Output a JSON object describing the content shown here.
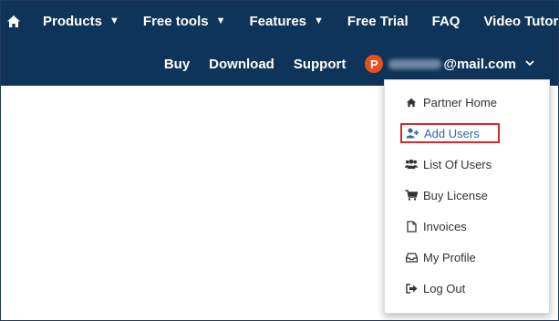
{
  "nav": {
    "home_icon": "home-icon",
    "top_items": [
      {
        "label": "Products",
        "has_dropdown": true
      },
      {
        "label": "Free tools",
        "has_dropdown": true
      },
      {
        "label": "Features",
        "has_dropdown": true
      },
      {
        "label": "Free Trial",
        "has_dropdown": false
      },
      {
        "label": "FAQ",
        "has_dropdown": false
      },
      {
        "label": "Video Tutorials",
        "has_dropdown": false
      }
    ],
    "bottom_items": [
      {
        "label": "Buy"
      },
      {
        "label": "Download"
      },
      {
        "label": "Support"
      }
    ],
    "account": {
      "avatar_letter": "P",
      "email_suffix": "@mail.com"
    }
  },
  "menu": {
    "items": [
      {
        "label": "Partner Home",
        "icon": "home-icon"
      },
      {
        "label": "Add Users",
        "icon": "user-plus-icon",
        "highlighted": true
      },
      {
        "label": "List Of Users",
        "icon": "users-icon"
      },
      {
        "label": "Buy License",
        "icon": "cart-icon"
      },
      {
        "label": "Invoices",
        "icon": "file-icon"
      },
      {
        "label": "My Profile",
        "icon": "inbox-icon"
      },
      {
        "label": "Log Out",
        "icon": "sign-out-icon"
      }
    ]
  },
  "colors": {
    "navbar": "#0f3459",
    "avatar": "#e8501d",
    "highlight_border": "#d12c2c",
    "highlight_text": "#2b6aa8"
  }
}
